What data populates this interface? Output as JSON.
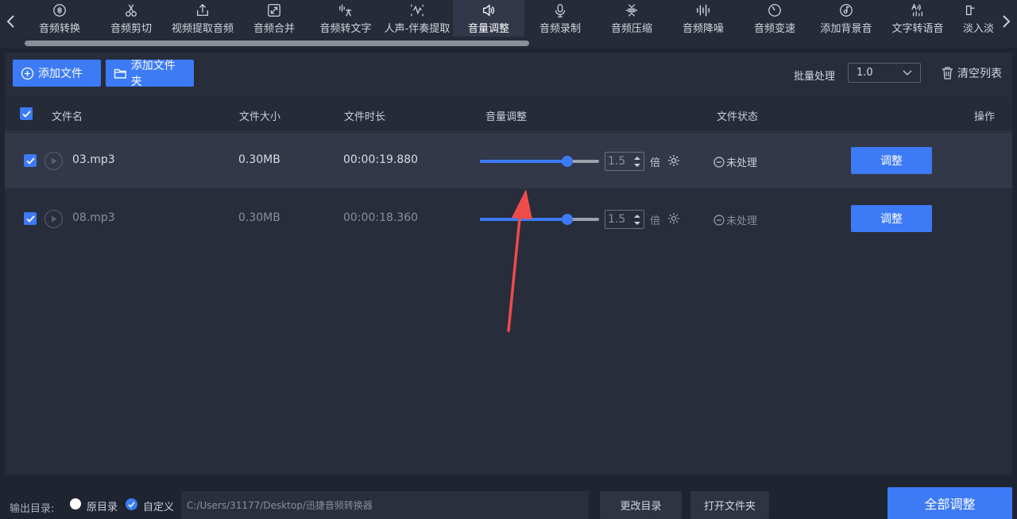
{
  "toolbar": {
    "items": [
      {
        "label": "音频转换",
        "icon": "waveform-circle-icon"
      },
      {
        "label": "音频剪切",
        "icon": "scissors-icon"
      },
      {
        "label": "视频提取音频",
        "icon": "upload-icon"
      },
      {
        "label": "音频合并",
        "icon": "merge-icon"
      },
      {
        "label": "音频转文字",
        "icon": "speech-to-text-icon"
      },
      {
        "label": "人声-伴奏提取",
        "icon": "vocal-split-icon"
      },
      {
        "label": "音量调整",
        "icon": "speaker-icon",
        "active": true
      },
      {
        "label": "音频录制",
        "icon": "microphone-icon"
      },
      {
        "label": "音频压缩",
        "icon": "compress-icon"
      },
      {
        "label": "音频降噪",
        "icon": "noise-bars-icon"
      },
      {
        "label": "音频变速",
        "icon": "speedometer-icon"
      },
      {
        "label": "添加背景音",
        "icon": "music-disc-icon"
      },
      {
        "label": "文字转语音",
        "icon": "text-to-speech-icon"
      },
      {
        "label": "淡入淡",
        "icon": "fade-icon"
      }
    ]
  },
  "actions": {
    "add_file": "添加文件",
    "add_folder": "添加文件夹",
    "batch_label": "批量处理",
    "batch_value": "1.0",
    "clear_list": "清空列表"
  },
  "table": {
    "headers": {
      "name": "文件名",
      "size": "文件大小",
      "duration": "文件时长",
      "volume": "音量调整",
      "status": "文件状态",
      "action": "操作"
    },
    "rows": [
      {
        "name": "03.mp3",
        "size": "0.30MB",
        "duration": "00:00:19.880",
        "volume": "1.5",
        "unit": "倍",
        "status": "未处理",
        "button": "调整",
        "slider_level": 0.73,
        "highlighted": true
      },
      {
        "name": "08.mp3",
        "size": "0.30MB",
        "duration": "00:00:18.360",
        "volume": "1.5",
        "unit": "倍",
        "status": "未处理",
        "button": "调整",
        "slider_level": 0.73,
        "highlighted": false
      }
    ]
  },
  "footer": {
    "output_label": "输出目录:",
    "radio_original": "原目录",
    "radio_custom": "自定义",
    "path": "C:/Users/31177/Desktop/迅捷音频转换器",
    "change_dir": "更改目录",
    "open_folder": "打开文件夹",
    "adjust_all": "全部调整"
  },
  "colors": {
    "accent": "#3c7af6",
    "background": "#1f2431",
    "panel": "#282d3b",
    "annotation_arrow": "#ef4b4b"
  }
}
